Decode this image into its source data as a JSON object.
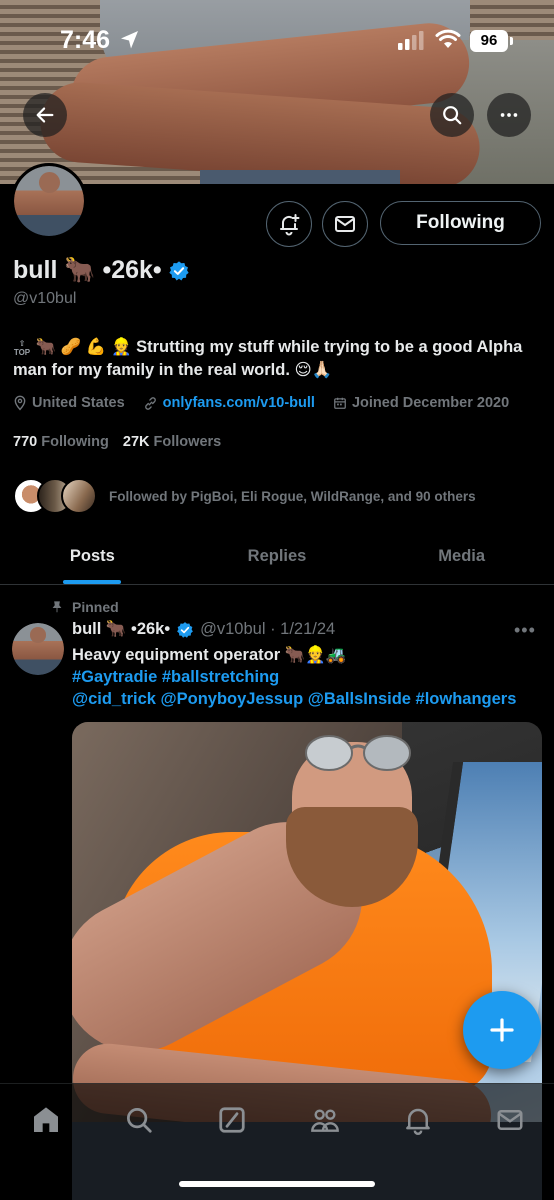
{
  "status_bar": {
    "time": "7:46",
    "battery": "96"
  },
  "profile": {
    "display_name": "bull 🐂 •26k•",
    "handle": "@v10bul",
    "bio_emojis": "🐂 🥜 💪 👷",
    "top_badge": "TOP",
    "bio_text": "Strutting my stuff while trying to be a good Alpha man for my family in the real world. 😌🙏🏻",
    "location": "United States",
    "website": "onlyfans.com/v10-bull",
    "joined": "Joined December 2020",
    "following_count": "770",
    "following_label": "Following",
    "followers_count": "27K",
    "followers_label": "Followers",
    "followed_by": "Followed by PigBoi, Eli Rogue, WildRange, and 90 others",
    "following_button": "Following",
    "verified": true
  },
  "tabs": [
    {
      "label": "Posts",
      "active": true
    },
    {
      "label": "Replies",
      "active": false
    },
    {
      "label": "Media",
      "active": false
    }
  ],
  "tweet": {
    "pinned_label": "Pinned",
    "name": "bull 🐂 •26k•",
    "handle_date": "@v10bul · 1/21/24",
    "more": "•••",
    "line1": "Heavy equipment operator 🐂👷🚜",
    "line2": "#Gaytradie #ballstretching",
    "line3": "@cid_trick @PonyboyJessup @BallsInside #lowhangers"
  },
  "icons": {
    "back": "back-arrow-icon",
    "search": "search-icon",
    "more": "more-icon",
    "notify": "notification-plus-icon",
    "message": "envelope-icon",
    "verified": "verified-badge-icon",
    "fab": "compose-plus-icon",
    "nav": [
      "home-icon",
      "search-icon",
      "grok-icon",
      "communities-icon",
      "notifications-icon",
      "messages-icon"
    ]
  },
  "colors": {
    "accent": "#1d9bf0",
    "background": "#000000",
    "muted": "#71767b",
    "text": "#e7e9ea"
  }
}
